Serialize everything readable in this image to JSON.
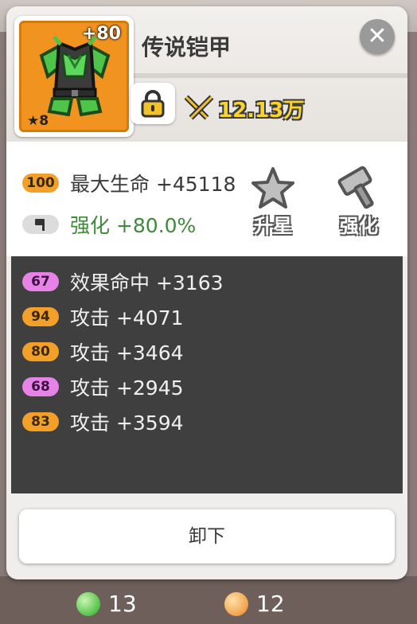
{
  "item": {
    "name": "传说铠甲",
    "enhance_level": "+80",
    "stars": "8",
    "star_symbol": "★",
    "power": "12.13万",
    "icon": "armor-icon",
    "rarity_color": "#f0931f"
  },
  "controls": {
    "close_icon": "✕",
    "lock_icon": "lock-icon"
  },
  "main_stats": [
    {
      "badge": "100",
      "badge_color": "orange",
      "text": "最大生命 +45118"
    },
    {
      "badge_icon": "hammer-icon",
      "text": "强化 +80.0%"
    }
  ],
  "actions": {
    "upgrade_star_label": "升星",
    "enhance_label": "强化"
  },
  "sub_stats": [
    {
      "badge": "67",
      "badge_color": "pink",
      "text": "效果命中 +3163"
    },
    {
      "badge": "94",
      "badge_color": "orange",
      "text": "攻击 +4071"
    },
    {
      "badge": "80",
      "badge_color": "orange",
      "text": "攻击 +3464"
    },
    {
      "badge": "68",
      "badge_color": "pink",
      "text": "攻击 +2945"
    },
    {
      "badge": "83",
      "badge_color": "orange",
      "text": "攻击 +3594"
    }
  ],
  "unequip_label": "卸下",
  "currency": [
    {
      "icon": "green-gem-icon",
      "value": "13"
    },
    {
      "icon": "orange-gem-icon",
      "value": "12"
    }
  ]
}
